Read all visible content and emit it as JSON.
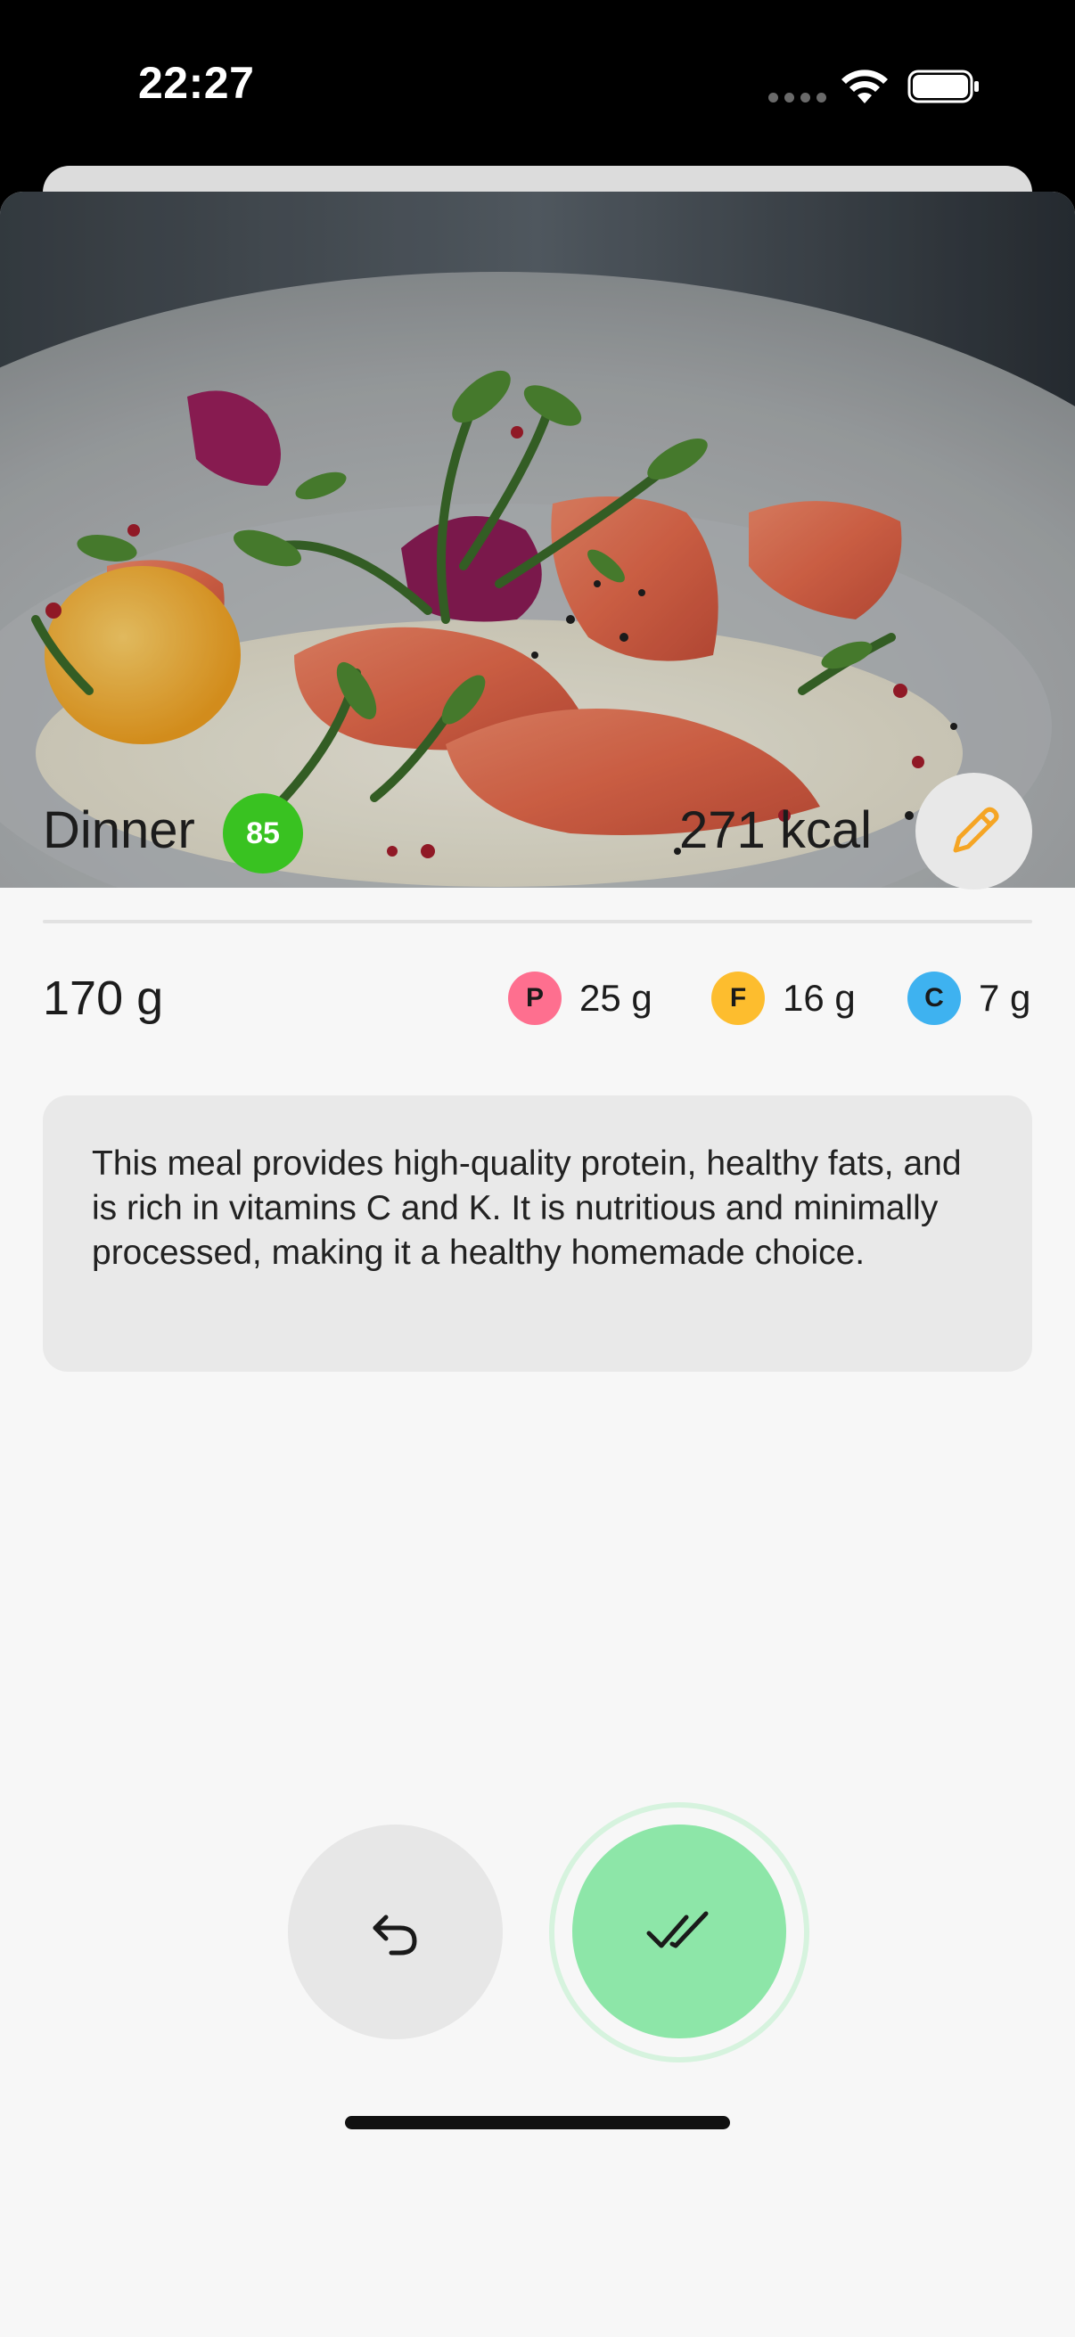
{
  "status_bar": {
    "time": "22:27"
  },
  "meal": {
    "name": "Dinner",
    "score": "85",
    "calories": "271 kcal",
    "weight": "170 g",
    "description": "This meal provides high-quality protein, healthy fats, and is rich in vitamins C and K. It is nutritious and minimally processed, making it a healthy homemade choice."
  },
  "macros": [
    {
      "letter": "P",
      "value": "25 g",
      "color": "#fe6f8f"
    },
    {
      "letter": "F",
      "value": "16 g",
      "color": "#fdbd2e"
    },
    {
      "letter": "C",
      "value": "7 g",
      "color": "#3eb2f0"
    }
  ],
  "colors": {
    "score_badge": "#39c221",
    "edit_icon": "#f5a524",
    "confirm_button": "#8de6a8",
    "background": "#f7f7f7"
  },
  "icons": {
    "edit": "pencil-icon",
    "undo": "undo-icon",
    "confirm": "double-check-icon"
  }
}
